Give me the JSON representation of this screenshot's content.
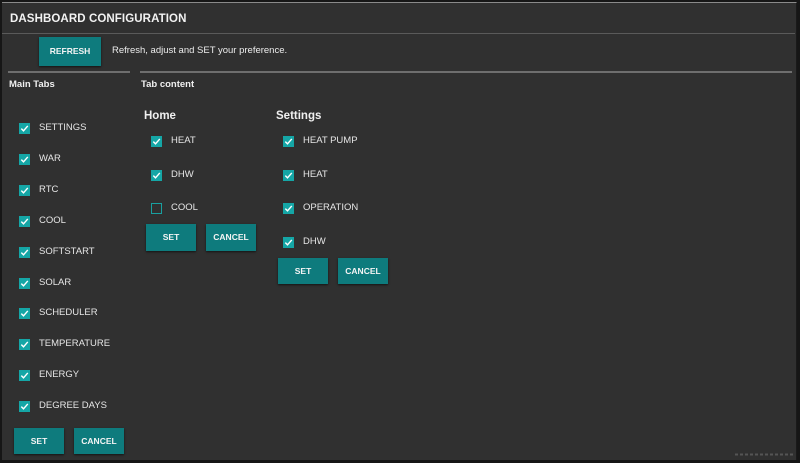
{
  "title": "DASHBOARD CONFIGURATION",
  "toolbar": {
    "refresh_label": "REFRESH",
    "hint": "Refresh, adjust and SET your preference."
  },
  "main_tabs": {
    "heading": "Main Tabs",
    "items": [
      {
        "label": "SETTINGS",
        "checked": true
      },
      {
        "label": "WAR",
        "checked": true
      },
      {
        "label": "RTC",
        "checked": true
      },
      {
        "label": "COOL",
        "checked": true
      },
      {
        "label": "SOFTSTART",
        "checked": true
      },
      {
        "label": "SOLAR",
        "checked": true
      },
      {
        "label": "SCHEDULER",
        "checked": true
      },
      {
        "label": "TEMPERATURE",
        "checked": true
      },
      {
        "label": "ENERGY",
        "checked": true
      },
      {
        "label": "DEGREE DAYS",
        "checked": true
      }
    ],
    "set_label": "SET",
    "cancel_label": "CANCEL"
  },
  "tab_content": {
    "heading": "Tab content",
    "home": {
      "title": "Home",
      "items": [
        {
          "label": "HEAT",
          "checked": true
        },
        {
          "label": "DHW",
          "checked": true
        },
        {
          "label": "COOL",
          "checked": false
        }
      ],
      "set_label": "SET",
      "cancel_label": "CANCEL"
    },
    "settings": {
      "title": "Settings",
      "items": [
        {
          "label": "HEAT PUMP",
          "checked": true
        },
        {
          "label": "HEAT",
          "checked": true
        },
        {
          "label": "OPERATION",
          "checked": true
        },
        {
          "label": "DHW",
          "checked": true
        }
      ],
      "set_label": "SET",
      "cancel_label": "CANCEL"
    }
  },
  "colors": {
    "accent": "#0e7b7d",
    "checkbox": "#15a6a6",
    "panel": "#303030",
    "background": "#161616"
  },
  "icons": {
    "checkmark": "check-icon",
    "resize": "resize-grip-icon"
  }
}
